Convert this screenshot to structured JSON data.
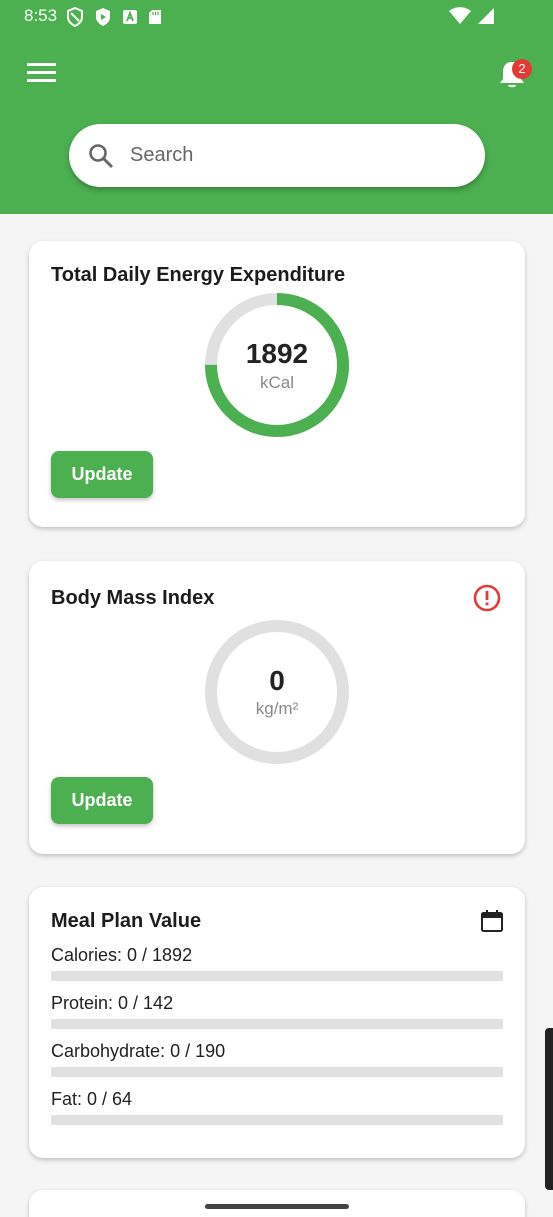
{
  "status_bar": {
    "time": "8:53"
  },
  "notifications": {
    "count": "2"
  },
  "search": {
    "placeholder": "Search"
  },
  "tdee": {
    "title": "Total Daily Energy Expenditure",
    "value": "1892",
    "unit": "kCal",
    "progress": 0.75,
    "button_label": "Update"
  },
  "bmi": {
    "title": "Body Mass Index",
    "value": "0",
    "unit": "kg/m²",
    "progress": 0,
    "button_label": "Update"
  },
  "meal_plan": {
    "title": "Meal Plan Value",
    "items": [
      {
        "label": "Calories: 0 / 1892",
        "progress": 0
      },
      {
        "label": "Protein: 0 / 142",
        "progress": 0
      },
      {
        "label": "Carbohydrate: 0 / 190",
        "progress": 0
      },
      {
        "label": "Fat: 0 / 64",
        "progress": 0
      }
    ]
  },
  "colors": {
    "accent": "#4caf50",
    "ring_track": "#e0e0e0",
    "alert": "#e53935"
  }
}
